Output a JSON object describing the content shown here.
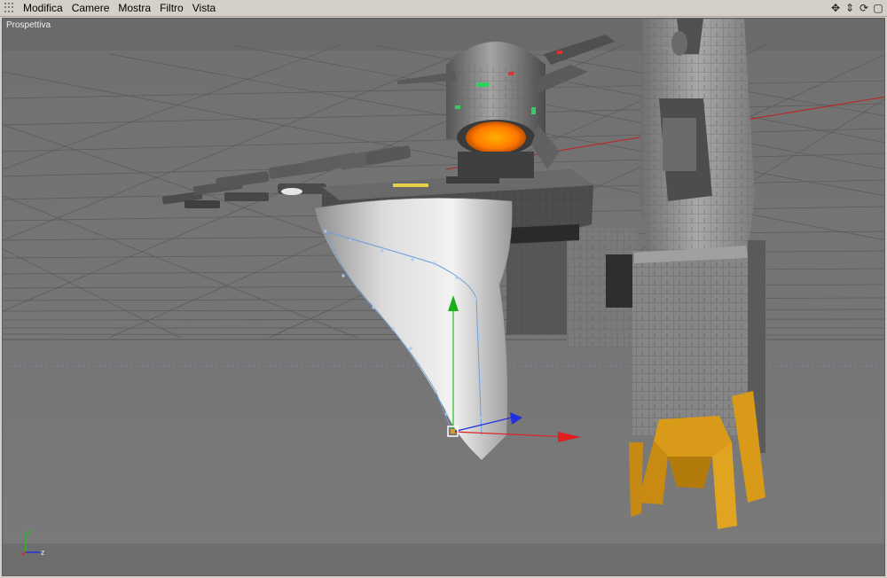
{
  "menubar": {
    "items": [
      "Modifica",
      "Camere",
      "Mostra",
      "Filtro",
      "Vista"
    ]
  },
  "nav_icons": [
    {
      "name": "move-view-icon",
      "glyph": "✥"
    },
    {
      "name": "zoom-view-icon",
      "glyph": "⇕"
    },
    {
      "name": "rotate-view-icon",
      "glyph": "⟳"
    },
    {
      "name": "maximize-view-icon",
      "glyph": "▢"
    }
  ],
  "viewport": {
    "title": "Prospettiva",
    "background": "#757575"
  },
  "axis_gizmo": {
    "y_label": "y",
    "z_label": "z"
  },
  "colors": {
    "axis_x": "#e02020",
    "axis_y": "#20c020",
    "axis_z": "#2030e0",
    "hull_light": "#d9d9d9",
    "metal_dark": "#4a4a4a",
    "landing_gear": "#d89a18",
    "engine_glow": "#ff8c00"
  }
}
